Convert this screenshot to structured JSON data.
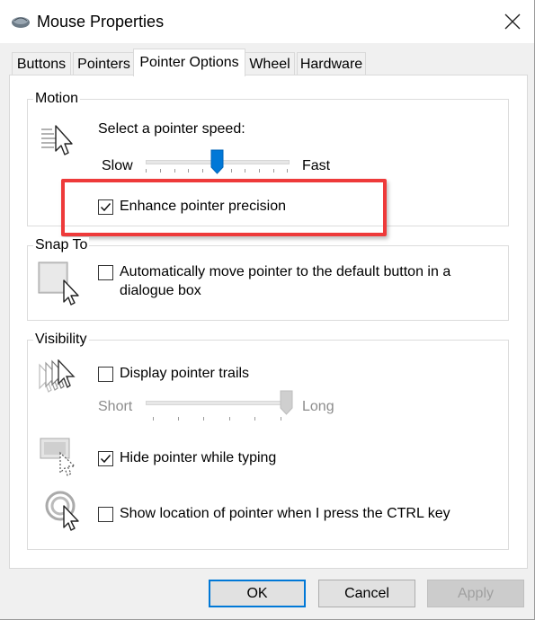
{
  "window": {
    "title": "Mouse Properties"
  },
  "icons": {
    "app": "mouse-icon",
    "close": "close-icon",
    "motion": "pointer-speed-icon",
    "snap": "snap-to-pointer-icon",
    "trails": "pointer-trails-icon",
    "hide": "hide-pointer-icon",
    "locate": "pointer-location-icon"
  },
  "tabs": [
    {
      "label": "Buttons",
      "active": false
    },
    {
      "label": "Pointers",
      "active": false
    },
    {
      "label": "Pointer Options",
      "active": true
    },
    {
      "label": "Wheel",
      "active": false
    },
    {
      "label": "Hardware",
      "active": false
    }
  ],
  "motion": {
    "group_label": "Motion",
    "speed_label": "Select a pointer speed:",
    "slow_label": "Slow",
    "fast_label": "Fast",
    "speed_level": 0.5,
    "enhance_label": "Enhance pointer precision",
    "enhance_checked": true
  },
  "snap": {
    "group_label": "Snap To",
    "label_line1": "Automatically move pointer to the default button in a",
    "label_line2": "dialogue box",
    "checked": false
  },
  "visibility": {
    "group_label": "Visibility",
    "trails_label": "Display pointer trails",
    "trails_checked": false,
    "short_label": "Short",
    "long_label": "Long",
    "trails_level": 1.0,
    "hide_label": "Hide pointer while typing",
    "hide_checked": true,
    "show_location_label": "Show location of pointer when I press the CTRL key",
    "show_location_checked": false
  },
  "buttons": {
    "ok": "OK",
    "cancel": "Cancel",
    "apply": "Apply"
  },
  "colors": {
    "accent": "#0078d7",
    "highlight": "#ee3a3a"
  }
}
